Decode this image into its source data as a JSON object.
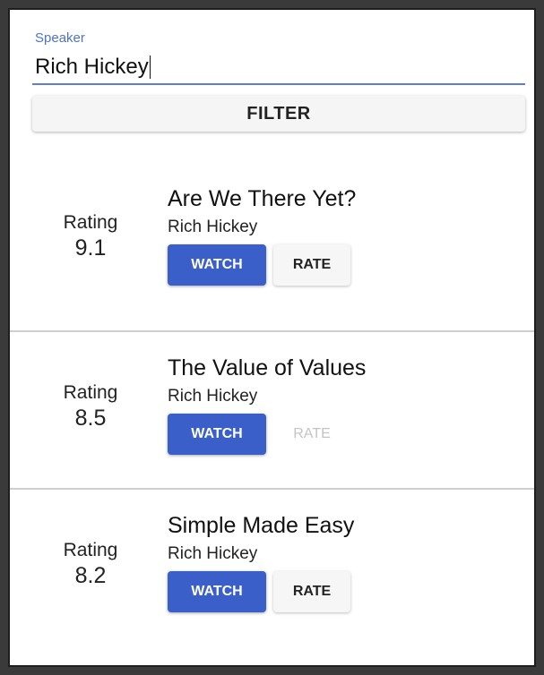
{
  "search": {
    "label": "Speaker",
    "value": "Rich Hickey"
  },
  "filter_button": {
    "label": "FILTER"
  },
  "talks": [
    {
      "rating_label": "Rating",
      "rating": "9.1",
      "title": "Are We There Yet?",
      "speaker": "Rich Hickey",
      "watch_label": "WATCH",
      "rate_label": "RATE",
      "rate_enabled": true
    },
    {
      "rating_label": "Rating",
      "rating": "8.5",
      "title": "The Value of Values",
      "speaker": "Rich Hickey",
      "watch_label": "WATCH",
      "rate_label": "RATE",
      "rate_enabled": false
    },
    {
      "rating_label": "Rating",
      "rating": "8.2",
      "title": "Simple Made Easy",
      "speaker": "Rich Hickey",
      "watch_label": "WATCH",
      "rate_label": "RATE",
      "rate_enabled": true
    }
  ],
  "colors": {
    "accent": "#3a5fc8",
    "label": "#4d72d1",
    "divider": "#cfcfcf"
  }
}
